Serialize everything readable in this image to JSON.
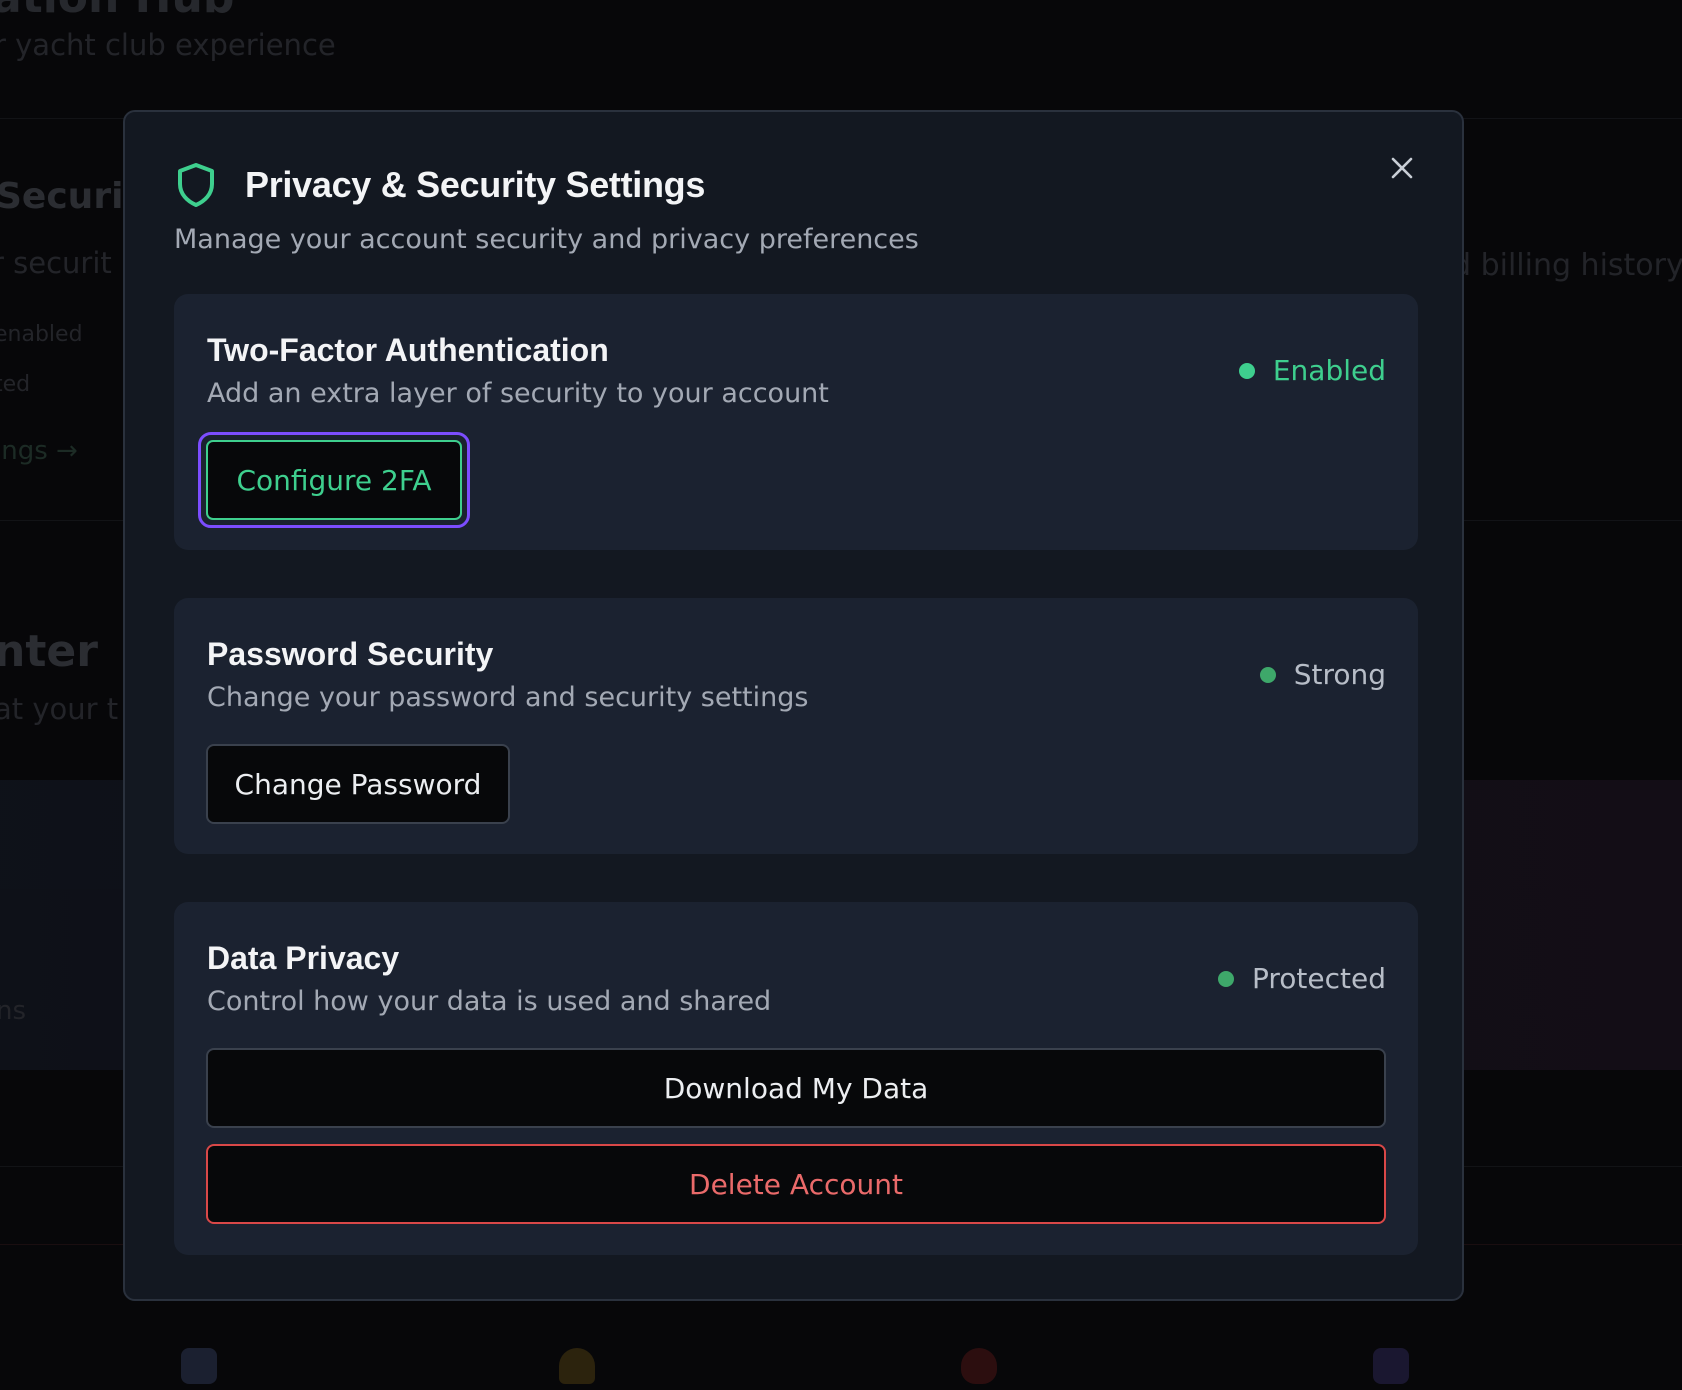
{
  "background": {
    "title": "ation Hub",
    "subtitle": "r yacht club experience",
    "security_title": "Securit",
    "security_desc": "r securit",
    "line1": "enabled",
    "line2": "ted",
    "settings_link": "ings →",
    "billing_text": "d billing history",
    "center_title": "nter",
    "center_desc": "at your t",
    "banner_text": "ns"
  },
  "modal": {
    "title": "Privacy & Security Settings",
    "subtitle": "Manage your account security and privacy preferences",
    "icon": "shield-icon",
    "close_icon": "close-icon",
    "accent_color": "#3ecf8e"
  },
  "sections": {
    "two_factor": {
      "title": "Two-Factor Authentication",
      "description": "Add an extra layer of security to your account",
      "status": "Enabled",
      "status_color": "#3ecf8e",
      "button": "Configure 2FA"
    },
    "password": {
      "title": "Password Security",
      "description": "Change your password and security settings",
      "status": "Strong",
      "button": "Change Password"
    },
    "data_privacy": {
      "title": "Data Privacy",
      "description": "Control how your data is used and shared",
      "status": "Protected",
      "download_button": "Download My Data",
      "delete_button": "Delete Account",
      "danger_color": "#e05a5a"
    }
  }
}
